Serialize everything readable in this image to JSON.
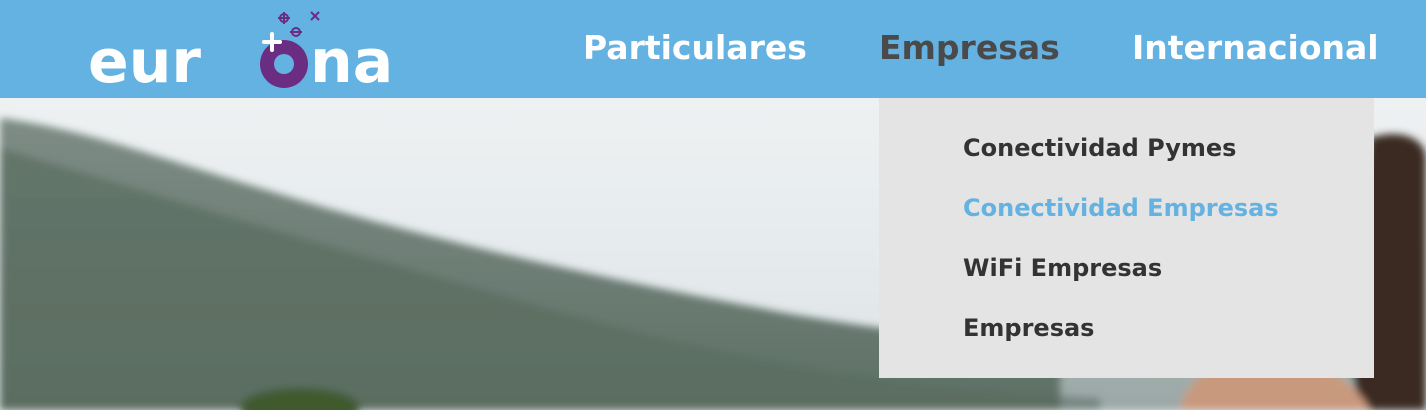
{
  "brand": {
    "logo_text": "eurona",
    "header_color": "#63b2e2",
    "accent_purple": "#6b2d82"
  },
  "nav": {
    "items": [
      {
        "label": "Particulares"
      },
      {
        "label": "Empresas",
        "active": true
      },
      {
        "label": "Internacional"
      }
    ]
  },
  "dropdown": {
    "parent": "Empresas",
    "items": [
      {
        "label": "Conectividad Pymes"
      },
      {
        "label": "Conectividad Empresas",
        "hovered": true
      },
      {
        "label": "WiFi Empresas"
      },
      {
        "label": "Empresas"
      }
    ]
  },
  "hero": {
    "image": "mountain-landscape-photo"
  }
}
